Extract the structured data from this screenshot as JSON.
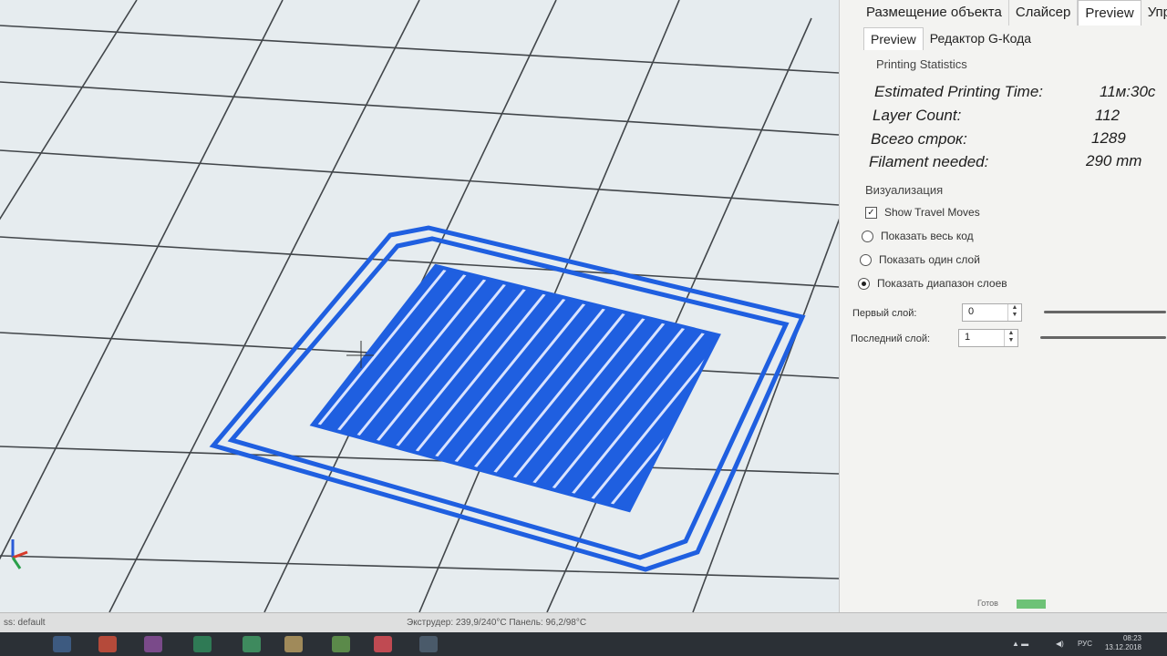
{
  "app": {
    "tabs": [
      {
        "label": "Размещение объекта"
      },
      {
        "label": "Слайсер"
      },
      {
        "label": "Preview",
        "active": true
      },
      {
        "label": "Управ"
      }
    ],
    "subtabs": [
      {
        "label": "Preview",
        "active": true
      },
      {
        "label": "Редактор G-Кода"
      }
    ]
  },
  "stats": {
    "group_label": "Printing Statistics",
    "rows": [
      {
        "label": "Estimated Printing Time:",
        "value": "11м:30с"
      },
      {
        "label": "Layer Count:",
        "value": "112"
      },
      {
        "label": "Всего строк:",
        "value": "1289"
      },
      {
        "label": "Filament needed:",
        "value": "290 mm"
      }
    ]
  },
  "visualization": {
    "group_label": "Визуализация",
    "show_travel_moves": {
      "label": "Show Travel Moves",
      "checked": true
    },
    "options": [
      {
        "label": "Показать весь код",
        "selected": false
      },
      {
        "label": "Показать один слой",
        "selected": false
      },
      {
        "label": "Показать диапазон слоев",
        "selected": true
      }
    ],
    "first_layer": {
      "label": "Первый слой:",
      "value": "0"
    },
    "last_layer": {
      "label": "Последний слой:",
      "value": "1"
    }
  },
  "status": {
    "left": "ss: default",
    "temps": "Экструдер: 239,9/240°C Панель: 96,2/98°C",
    "ready_label": "Готов"
  },
  "taskbar": {
    "lang": "РУС",
    "time": "08:23",
    "date": "13.12.2018"
  },
  "colors": {
    "accent_blue": "#1f5fe0",
    "viewport_bg": "#e6ecef",
    "ready_green": "#6ec277"
  },
  "icons": [
    "folder-icon",
    "app-icon",
    "browser-icon",
    "printer-icon",
    "network-icon",
    "volume-icon"
  ]
}
